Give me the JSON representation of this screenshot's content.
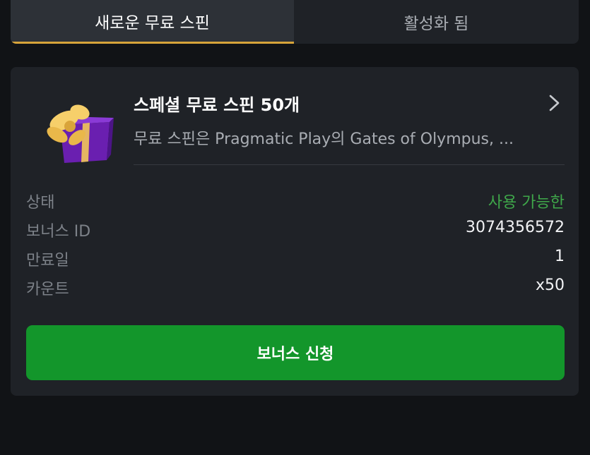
{
  "tabs": [
    {
      "label": "새로운 무료 스핀",
      "active": true
    },
    {
      "label": "활성화 됨",
      "active": false
    }
  ],
  "offer": {
    "title": "스페셜 무료 스핀 50개",
    "description": "무료 스핀은 Pragmatic Play의 Gates of Olympus, ...",
    "icon": "gift-icon"
  },
  "details": [
    {
      "key": "상태",
      "value": "사용 가능한",
      "status": "available"
    },
    {
      "key": "보너스 ID",
      "value": "3074356572"
    },
    {
      "key": "만료일",
      "value": "1"
    },
    {
      "key": "카운트",
      "value": "x50"
    }
  ],
  "button": {
    "label": "보너스 신청"
  },
  "colors": {
    "accent_underline": "#d8a43a",
    "status_green": "#3fa84a",
    "button_green": "#13962b",
    "gift_box": "#6a1fb0",
    "gift_ribbon": "#f3c75a"
  }
}
